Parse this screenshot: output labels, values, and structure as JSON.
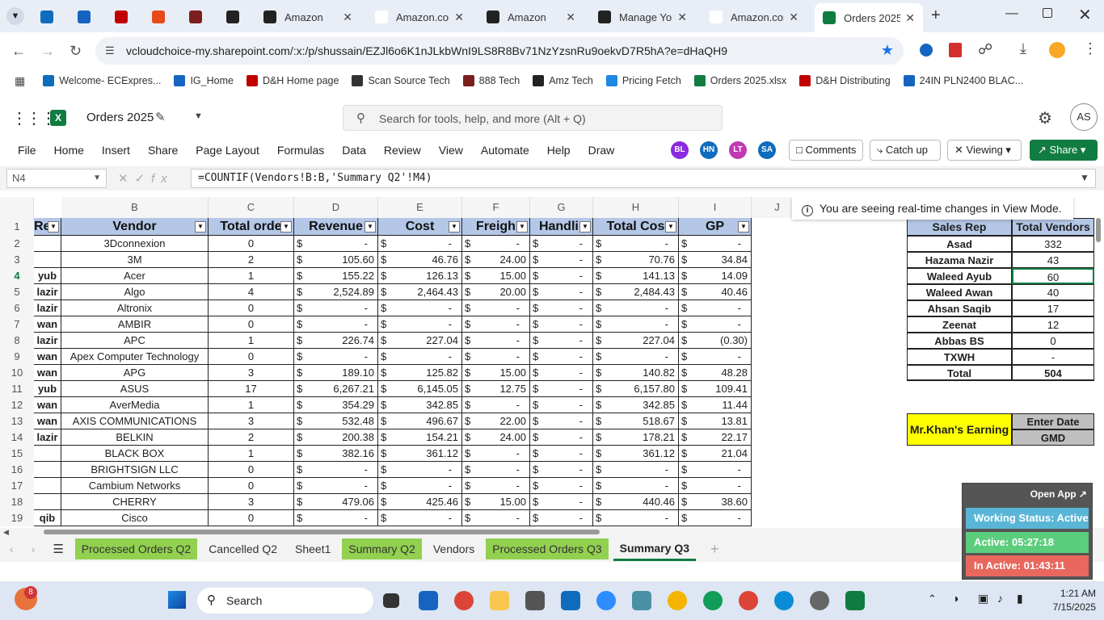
{
  "browser": {
    "tabs": [
      {
        "title": "",
        "icon": "ec-icon",
        "color": "#0f6cbd"
      },
      {
        "title": "",
        "icon": "ig-icon",
        "color": "#1565c0"
      },
      {
        "title": "",
        "icon": "dh-icon",
        "color": "#c00000"
      },
      {
        "title": "",
        "icon": "s-icon",
        "color": "#e64a19"
      },
      {
        "title": "",
        "icon": "888-icon",
        "color": "#7b1f1f"
      },
      {
        "title": "",
        "icon": "amazon-icon",
        "color": "#222"
      },
      {
        "title": "Amazon",
        "icon": "amazon-icon",
        "color": "#222"
      },
      {
        "title": "Amazon.com",
        "icon": "amazon-icon",
        "color": "#fff"
      },
      {
        "title": "Amazon",
        "icon": "amazon-icon",
        "color": "#222"
      },
      {
        "title": "Manage You",
        "icon": "amazon-icon",
        "color": "#222"
      },
      {
        "title": "Amazon.com",
        "icon": "amazon-icon",
        "color": "#fff"
      },
      {
        "title": "Orders 2025",
        "icon": "excel-icon",
        "color": "#107c41"
      }
    ],
    "url": "vcloudchoice-my.sharepoint.com/:x:/p/shussain/EZJl6o6K1nJLkbWnI9LS8R8Bv71NzYzsnRu9oekvD7R5hA?e=dHaQH9",
    "bookmarks": [
      {
        "label": "Welcome- ECExpres...",
        "color": "#0f6cbd"
      },
      {
        "label": "IG_Home",
        "color": "#1565c0"
      },
      {
        "label": "D&H Home page",
        "color": "#c00000"
      },
      {
        "label": "Scan Source Tech",
        "color": "#333"
      },
      {
        "label": "888 Tech",
        "color": "#7b1f1f"
      },
      {
        "label": "Amz Tech",
        "color": "#222"
      },
      {
        "label": "Pricing Fetch",
        "color": "#1e88e5"
      },
      {
        "label": "Orders 2025.xlsx",
        "color": "#107c41"
      },
      {
        "label": "D&H Distributing",
        "color": "#c00000"
      },
      {
        "label": "24IN PLN2400 BLAC...",
        "color": "#1565c0"
      }
    ]
  },
  "excel": {
    "filename": "Orders 2025",
    "search_placeholder": "Search for tools, help, and more (Alt + Q)",
    "user_initials": "AS",
    "ribbon_tabs": [
      "File",
      "Home",
      "Insert",
      "Share",
      "Page Layout",
      "Formulas",
      "Data",
      "Review",
      "View",
      "Automate",
      "Help",
      "Draw"
    ],
    "collaborators": [
      {
        "initials": "BL",
        "color": "#8a2be2"
      },
      {
        "initials": "HN",
        "color": "#0f6cbd"
      },
      {
        "initials": "LT",
        "color": "#c239b3"
      },
      {
        "initials": "SA",
        "color": "#0f6cbd"
      }
    ],
    "comments_label": "Comments",
    "catchup_label": "Catch up",
    "viewing_label": "Viewing",
    "share_label": "Share",
    "name_box": "N4",
    "formula": "=COUNTIF(Vendors!B:B,'Summary Q2'!M4)",
    "view_mode_notice": "You are seeing real-time changes in View Mode.",
    "col_letters": [
      "B",
      "C",
      "D",
      "E",
      "F",
      "G",
      "H",
      "I",
      "J"
    ],
    "row_numbers": [
      "1",
      "2",
      "3",
      "4",
      "5",
      "6",
      "7",
      "8",
      "9",
      "10",
      "11",
      "12",
      "13",
      "14",
      "15",
      "16",
      "17",
      "18",
      "19"
    ],
    "headers": [
      "Re",
      "Vendor",
      "Total orde",
      "Revenue",
      "Cost",
      "Freigh",
      "Handlir",
      "Total Cos",
      "GP"
    ],
    "rows": [
      {
        "rep": "",
        "vendor": "3Dconnexion",
        "orders": "0",
        "rev": "-",
        "cost": "-",
        "freight": "-",
        "handling": "-",
        "total": "-",
        "gp": "-"
      },
      {
        "rep": "",
        "vendor": "3M",
        "orders": "2",
        "rev": "105.60",
        "cost": "46.76",
        "freight": "24.00",
        "handling": "-",
        "total": "70.76",
        "gp": "34.84"
      },
      {
        "rep": "yub",
        "vendor": "Acer",
        "orders": "1",
        "rev": "155.22",
        "cost": "126.13",
        "freight": "15.00",
        "handling": "-",
        "total": "141.13",
        "gp": "14.09"
      },
      {
        "rep": "lazir",
        "vendor": "Algo",
        "orders": "4",
        "rev": "2,524.89",
        "cost": "2,464.43",
        "freight": "20.00",
        "handling": "-",
        "total": "2,484.43",
        "gp": "40.46"
      },
      {
        "rep": "lazir",
        "vendor": "Altronix",
        "orders": "0",
        "rev": "-",
        "cost": "-",
        "freight": "-",
        "handling": "-",
        "total": "-",
        "gp": "-"
      },
      {
        "rep": "wan",
        "vendor": "AMBIR",
        "orders": "0",
        "rev": "-",
        "cost": "-",
        "freight": "-",
        "handling": "-",
        "total": "-",
        "gp": "-"
      },
      {
        "rep": "lazir",
        "vendor": "APC",
        "orders": "1",
        "rev": "226.74",
        "cost": "227.04",
        "freight": "-",
        "handling": "-",
        "total": "227.04",
        "gp": "(0.30)"
      },
      {
        "rep": "wan",
        "vendor": "Apex Computer Technology",
        "orders": "0",
        "rev": "-",
        "cost": "-",
        "freight": "-",
        "handling": "-",
        "total": "-",
        "gp": "-"
      },
      {
        "rep": "wan",
        "vendor": "APG",
        "orders": "3",
        "rev": "189.10",
        "cost": "125.82",
        "freight": "15.00",
        "handling": "-",
        "total": "140.82",
        "gp": "48.28"
      },
      {
        "rep": "yub",
        "vendor": "ASUS",
        "orders": "17",
        "rev": "6,267.21",
        "cost": "6,145.05",
        "freight": "12.75",
        "handling": "-",
        "total": "6,157.80",
        "gp": "109.41"
      },
      {
        "rep": "wan",
        "vendor": "AverMedia",
        "orders": "1",
        "rev": "354.29",
        "cost": "342.85",
        "freight": "-",
        "handling": "-",
        "total": "342.85",
        "gp": "11.44"
      },
      {
        "rep": "wan",
        "vendor": "AXIS COMMUNICATIONS",
        "orders": "3",
        "rev": "532.48",
        "cost": "496.67",
        "freight": "22.00",
        "handling": "-",
        "total": "518.67",
        "gp": "13.81"
      },
      {
        "rep": "lazir",
        "vendor": "BELKIN",
        "orders": "2",
        "rev": "200.38",
        "cost": "154.21",
        "freight": "24.00",
        "handling": "-",
        "total": "178.21",
        "gp": "22.17"
      },
      {
        "rep": "",
        "vendor": "BLACK BOX",
        "orders": "1",
        "rev": "382.16",
        "cost": "361.12",
        "freight": "-",
        "handling": "-",
        "total": "361.12",
        "gp": "21.04"
      },
      {
        "rep": "",
        "vendor": "BRIGHTSIGN LLC",
        "orders": "0",
        "rev": "-",
        "cost": "-",
        "freight": "-",
        "handling": "-",
        "total": "-",
        "gp": "-"
      },
      {
        "rep": "",
        "vendor": "Cambium Networks",
        "orders": "0",
        "rev": "-",
        "cost": "-",
        "freight": "-",
        "handling": "-",
        "total": "-",
        "gp": "-"
      },
      {
        "rep": "",
        "vendor": "CHERRY",
        "orders": "3",
        "rev": "479.06",
        "cost": "425.46",
        "freight": "15.00",
        "handling": "-",
        "total": "440.46",
        "gp": "38.60"
      },
      {
        "rep": "qib",
        "vendor": "Cisco",
        "orders": "0",
        "rev": "-",
        "cost": "-",
        "freight": "-",
        "handling": "-",
        "total": "-",
        "gp": "-"
      }
    ],
    "currency": "$",
    "summary_headers": [
      "Sales Rep",
      "Total Vendors"
    ],
    "summary_rows": [
      [
        "Asad",
        "332"
      ],
      [
        "Hazama Nazir",
        "43"
      ],
      [
        "Waleed Ayub",
        "60"
      ],
      [
        "Waleed Awan",
        "40"
      ],
      [
        "Ahsan Saqib",
        "17"
      ],
      [
        "Zeenat",
        "12"
      ],
      [
        "Abbas BS",
        "0"
      ],
      [
        "TXWH",
        "-"
      ],
      [
        "Total",
        "504"
      ]
    ],
    "earning_label": "Mr.Khan's Earning",
    "enter_date_label": "Enter Date",
    "gmd_label": "GMD",
    "sheet_tabs": [
      {
        "label": "Processed Orders Q2",
        "green": true,
        "active": false
      },
      {
        "label": "Cancelled Q2",
        "green": false,
        "active": false
      },
      {
        "label": "Sheet1",
        "green": false,
        "active": false
      },
      {
        "label": "Summary Q2",
        "green": true,
        "active": false
      },
      {
        "label": "Vendors",
        "green": false,
        "active": false
      },
      {
        "label": "Processed Orders Q3",
        "green": true,
        "active": false
      },
      {
        "label": "Summary Q3",
        "green": false,
        "active": true
      }
    ]
  },
  "widget": {
    "open_app": "Open App ↗",
    "working_status": "Working Status: Active",
    "active_time": "Active: 05:27:18",
    "inactive_time": "In Active: 01:43:11"
  },
  "taskbar": {
    "notification_count": "8",
    "search_label": "Search",
    "time": "1:21 AM",
    "date": "7/15/2025"
  }
}
